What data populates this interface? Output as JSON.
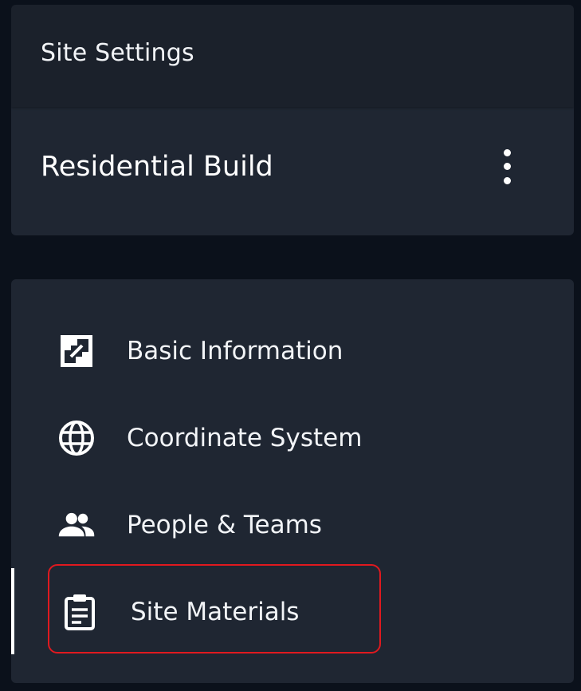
{
  "header": {
    "title": "Site Settings"
  },
  "project": {
    "name": "Residential Build",
    "menu_icon": "kebab-menu-icon"
  },
  "nav": {
    "items": [
      {
        "label": "Basic Information",
        "icon": "basic-information-icon",
        "active": false
      },
      {
        "label": "Coordinate System",
        "icon": "globe-icon",
        "active": false
      },
      {
        "label": "People & Teams",
        "icon": "people-icon",
        "active": false
      },
      {
        "label": "Site Materials",
        "icon": "clipboard-icon",
        "active": true
      }
    ]
  },
  "colors": {
    "page_background": "#0b111b",
    "card_background": "#1f2632",
    "header_background": "#1b212b",
    "highlight_border": "#e0191f",
    "text": "#ffffff"
  }
}
